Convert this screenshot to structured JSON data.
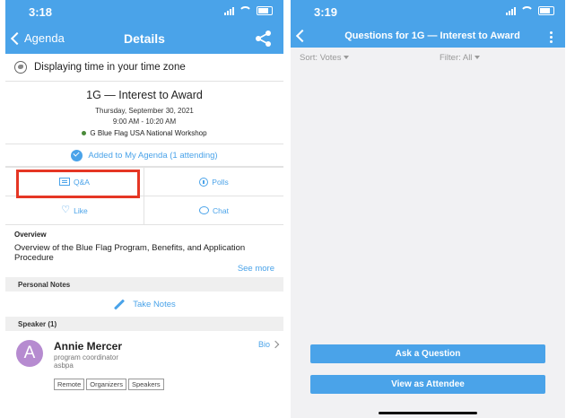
{
  "left": {
    "status_time": "3:18",
    "nav": {
      "back_label": "Agenda",
      "title": "Details"
    },
    "timezone_text": "Displaying time in your time zone",
    "session": {
      "title": "1G — Interest to Award",
      "date": "Thursday, September 30, 2021",
      "time": "9:00 AM - 10:20 AM",
      "location": "G Blue Flag USA National Workshop"
    },
    "agenda_status": "Added to My Agenda (1 attending)",
    "actions": {
      "qa": "Q&A",
      "polls": "Polls",
      "like": "Like",
      "chat": "Chat"
    },
    "overview": {
      "heading": "Overview",
      "text": "Overview of the Blue Flag Program, Benefits, and Application Procedure",
      "see_more": "See more"
    },
    "personal_notes": {
      "heading": "Personal Notes",
      "take_notes": "Take Notes"
    },
    "speaker_section": "Speaker (1)",
    "speaker": {
      "initial": "A",
      "name": "Annie Mercer",
      "role": "program coordinator",
      "org": "asbpa",
      "bio_label": "Bio",
      "tags": [
        "Remote",
        "Organizers",
        "Speakers"
      ]
    },
    "colors": {
      "accent": "#4aa3e9",
      "highlight_box": "#e53624",
      "avatar": "#b68bd0"
    }
  },
  "right": {
    "status_time": "3:19",
    "nav_title": "Questions for 1G — Interest to Award",
    "sort_label": "Sort: Votes",
    "filter_label": "Filter: All",
    "ask_button": "Ask a Question",
    "attendee_button": "View as Attendee"
  }
}
